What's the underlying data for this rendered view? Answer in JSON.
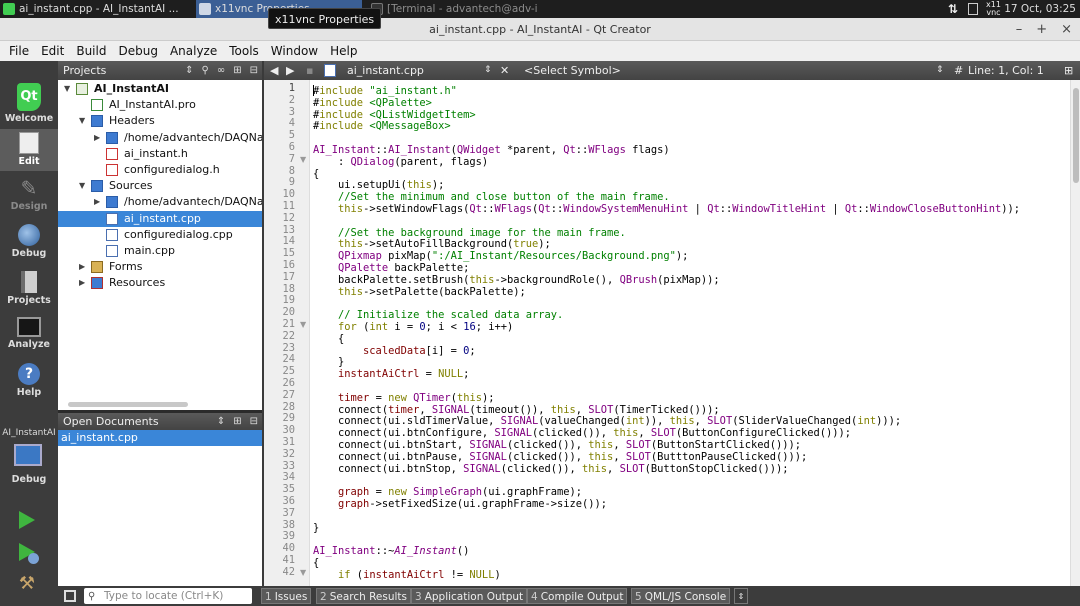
{
  "taskbar": {
    "tasks": [
      {
        "label": "ai_instant.cpp - AI_InstantAI ...",
        "icon": "qt-creator-icon"
      },
      {
        "label": "x11vnc Properties",
        "icon": "window-icon",
        "active": true
      },
      {
        "label": "[Terminal - advantech@adv-i...",
        "icon": "terminal-icon"
      }
    ],
    "tooltip": "x11vnc Properties",
    "tray_x11": "x11",
    "tray_vnc": "vnc",
    "clock": "17 Oct, 03:25"
  },
  "window": {
    "title": "ai_instant.cpp - AI_InstantAI - Qt Creator",
    "controls": [
      "–",
      "+",
      "×"
    ]
  },
  "menubar": [
    "File",
    "Edit",
    "Build",
    "Debug",
    "Analyze",
    "Tools",
    "Window",
    "Help"
  ],
  "modes": {
    "welcome": "Welcome",
    "edit": "Edit",
    "design": "Design",
    "debug": "Debug",
    "projects": "Projects",
    "analyze": "Analyze",
    "help": "Help",
    "qt_glyph": "Qt"
  },
  "kit": {
    "project": "AI_InstantAI",
    "mode": "Debug"
  },
  "projects_panel": {
    "title": "Projects",
    "tree": [
      {
        "label": "AI_InstantAI",
        "icon": "project",
        "expanded": true,
        "bold": true
      },
      {
        "label": "AI_InstantAI.pro",
        "icon": "pro"
      },
      {
        "label": "Headers",
        "icon": "folder",
        "expanded": true
      },
      {
        "label": "/home/advantech/DAQNavi",
        "icon": "folder",
        "expanded": false
      },
      {
        "label": "ai_instant.h",
        "icon": "h"
      },
      {
        "label": "configuredialog.h",
        "icon": "h"
      },
      {
        "label": "Sources",
        "icon": "folder",
        "expanded": true
      },
      {
        "label": "/home/advantech/DAQNavi/",
        "icon": "folder",
        "expanded": false
      },
      {
        "label": "ai_instant.cpp",
        "icon": "cpp",
        "selected": true
      },
      {
        "label": "configuredialog.cpp",
        "icon": "cpp"
      },
      {
        "label": "main.cpp",
        "icon": "cpp"
      },
      {
        "label": "Forms",
        "icon": "forms",
        "expanded": false
      },
      {
        "label": "Resources",
        "icon": "res",
        "expanded": false
      }
    ]
  },
  "open_documents": {
    "title": "Open Documents",
    "items": [
      "ai_instant.cpp"
    ]
  },
  "editor": {
    "file": "ai_instant.cpp",
    "symbol": "<Select Symbol>",
    "hash": "#",
    "position": "Line: 1, Col: 1",
    "lines": [
      "#include \"ai_instant.h\"",
      "#include <QPalette>",
      "#include <QListWidgetItem>",
      "#include <QMessageBox>",
      "",
      "AI_Instant::AI_Instant(QWidget *parent, Qt::WFlags flags)",
      "    : QDialog(parent, flags)",
      "{",
      "    ui.setupUi(this);",
      "    //Set the minimum and close button of the main frame.",
      "    this->setWindowFlags(Qt::WFlags(Qt::WindowSystemMenuHint | Qt::WindowTitleHint | Qt::WindowCloseButtonHint));",
      "",
      "    //Set the background image for the main frame.",
      "    this->setAutoFillBackground(true);",
      "    QPixmap pixMap(\":/AI_Instant/Resources/Background.png\");",
      "    QPalette backPalette;",
      "    backPalette.setBrush(this->backgroundRole(), QBrush(pixMap));",
      "    this->setPalette(backPalette);",
      "",
      "    // Initialize the scaled data array.",
      "    for (int i = 0; i < 16; i++)",
      "    {",
      "        scaledData[i] = 0;",
      "    }",
      "    instantAiCtrl = NULL;",
      "",
      "    timer = new QTimer(this);",
      "    connect(timer, SIGNAL(timeout()), this, SLOT(TimerTicked()));",
      "    connect(ui.sldTimerValue, SIGNAL(valueChanged(int)), this, SLOT(SliderValueChanged(int)));",
      "    connect(ui.btnConfigure, SIGNAL(clicked()), this, SLOT(ButtonConfigureClicked()));",
      "    connect(ui.btnStart, SIGNAL(clicked()), this, SLOT(ButtonStartClicked()));",
      "    connect(ui.btnPause, SIGNAL(clicked()), this, SLOT(ButttonPauseClicked()));",
      "    connect(ui.btnStop, SIGNAL(clicked()), this, SLOT(ButtonStopClicked()));",
      "",
      "    graph = new SimpleGraph(ui.graphFrame);",
      "    graph->setFixedSize(ui.graphFrame->size());",
      "",
      "}",
      "",
      "AI_Instant::~AI_Instant()",
      "{",
      "    if (instantAiCtrl != NULL)"
    ],
    "fold_lines": [
      7,
      21,
      42
    ]
  },
  "statusbar": {
    "locator_placeholder": "Type to locate (Ctrl+K)",
    "panes": [
      {
        "num": "1",
        "label": "Issues"
      },
      {
        "num": "2",
        "label": "Search Results"
      },
      {
        "num": "3",
        "label": "Application Output"
      },
      {
        "num": "4",
        "label": "Compile Output"
      },
      {
        "num": "5",
        "label": "QML/JS Console"
      }
    ]
  },
  "colors": {
    "selection": "#3a86d8",
    "keyword": "#808000",
    "string": "#008000",
    "type": "#800080",
    "number": "#000080",
    "run": "#3fb53f"
  }
}
